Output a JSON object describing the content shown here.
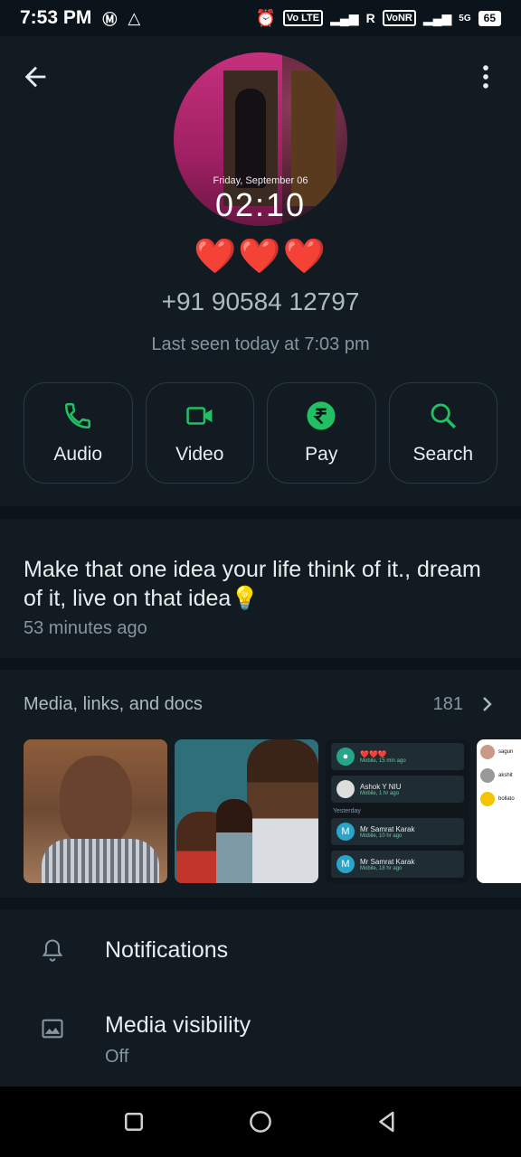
{
  "status_bar": {
    "time": "7:53 PM",
    "volte": "Vo LTE",
    "roaming": "R",
    "vonr": "VoNR",
    "network": "5G",
    "battery": "65"
  },
  "profile": {
    "lock_date": "Friday, September 06",
    "lock_time": "02:10",
    "name": "❤️❤️❤️",
    "phone": "+91 90584 12797",
    "last_seen": "Last seen today at 7:03 pm"
  },
  "actions": [
    {
      "label": "Audio",
      "icon": "phone-icon"
    },
    {
      "label": "Video",
      "icon": "video-icon"
    },
    {
      "label": "Pay",
      "icon": "rupee-icon"
    },
    {
      "label": "Search",
      "icon": "search-icon"
    }
  ],
  "about": {
    "text": "Make that one idea your life think of it., dream of it, live on that idea💡",
    "time": "53 minutes ago"
  },
  "media": {
    "title": "Media, links, and docs",
    "count": "181",
    "call_log": {
      "rows": [
        {
          "title": "❤️❤️❤️",
          "sub": "Mobile, 15 min ago"
        },
        {
          "title": "Ashok Y NIU",
          "sub": "Mobile, 1 hr ago"
        },
        {
          "title": "Mr Samrat Karak",
          "sub": "Mobile, 10 hr ago"
        },
        {
          "title": "Mr Samrat Karak",
          "sub": "Mobile, 18 hr ago"
        }
      ],
      "yesterday": "Yesterday"
    },
    "contacts": [
      "sagun",
      "akshit",
      "bollato"
    ]
  },
  "settings": {
    "notifications": "Notifications",
    "media_visibility": "Media visibility",
    "media_visibility_value": "Off"
  },
  "colors": {
    "accent": "#21c063",
    "background": "#0b141a",
    "surface": "#111b21"
  }
}
